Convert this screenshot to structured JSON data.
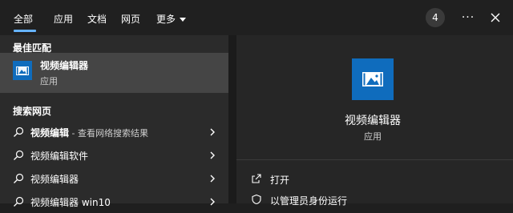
{
  "tabs": [
    {
      "label": "全部",
      "active": true
    },
    {
      "label": "应用"
    },
    {
      "label": "文档"
    },
    {
      "label": "网页"
    },
    {
      "label": "更多"
    }
  ],
  "header": {
    "badge_count": "4",
    "more_label": "···",
    "accent": "#66b3ff"
  },
  "left": {
    "best_match_heading": "最佳匹配",
    "best_match": {
      "title": "视频编辑器",
      "subtitle": "应用"
    },
    "web_heading": "搜索网页",
    "web_results": [
      {
        "main": "视频编辑",
        "hint": " - 查看网络搜索结果"
      },
      {
        "main": "视频编辑软件",
        "hint": ""
      },
      {
        "main": "视频编辑器",
        "hint": ""
      },
      {
        "main": "视频编辑器 win10",
        "hint": ""
      }
    ]
  },
  "right": {
    "title": "视频编辑器",
    "subtitle": "应用",
    "actions": [
      {
        "label": "打开",
        "icon": "open-icon"
      },
      {
        "label": "以管理员身份运行",
        "icon": "admin-shield-icon"
      }
    ]
  },
  "colors": {
    "app_icon_bg": "#0f6cbd",
    "selected_row": "#454545"
  }
}
